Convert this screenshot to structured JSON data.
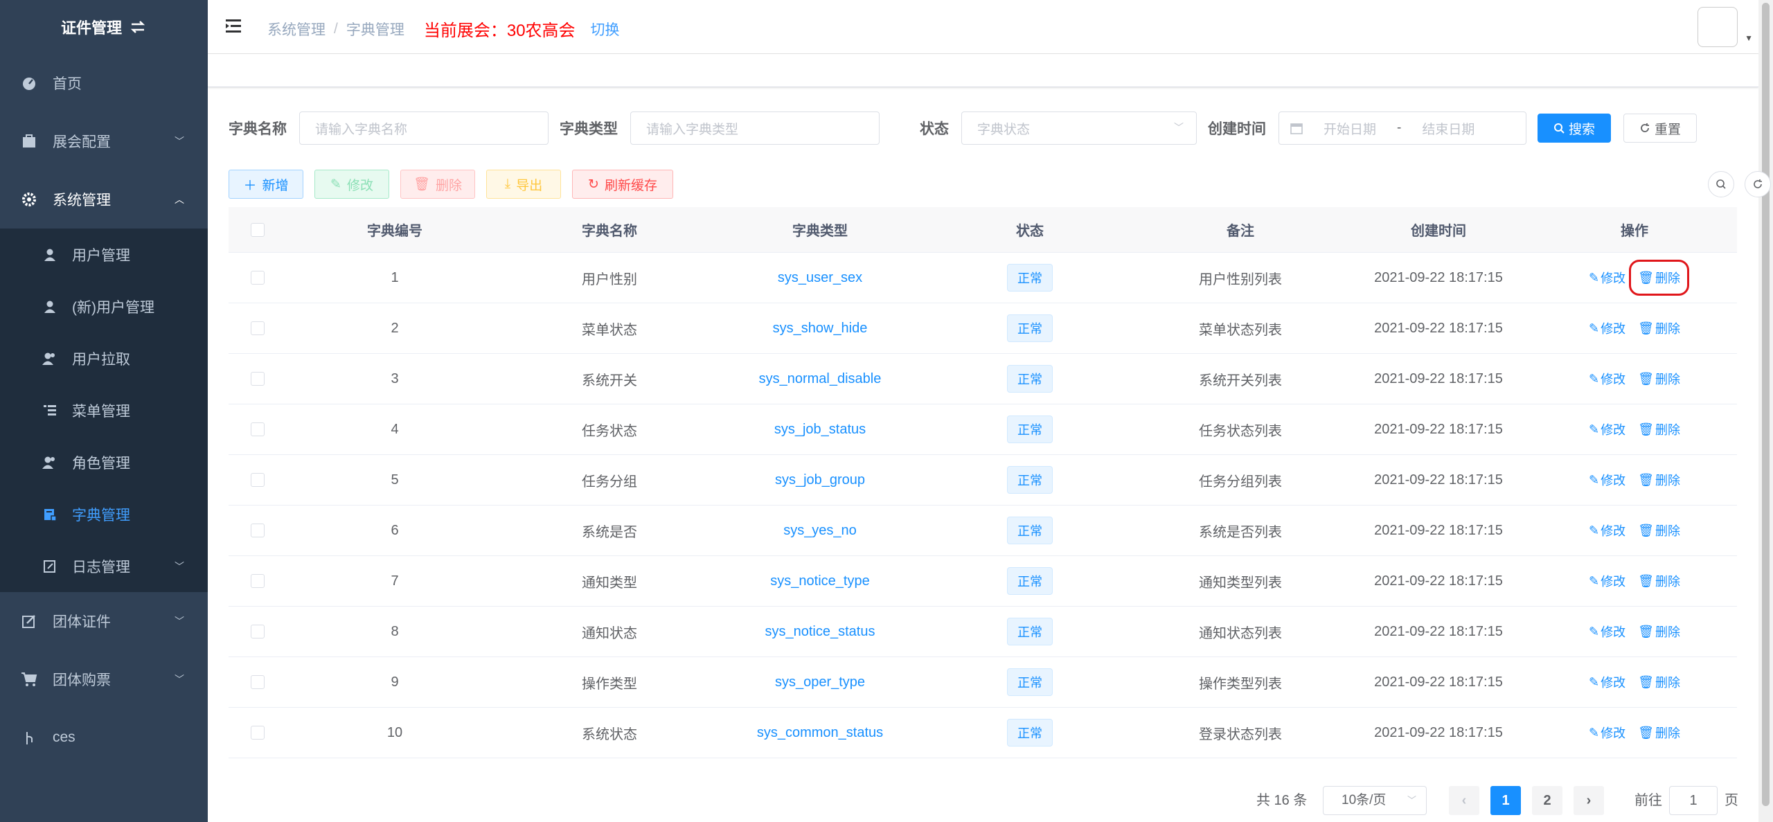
{
  "sidebar": {
    "logo": "证件管理",
    "items": [
      {
        "label": "首页"
      },
      {
        "label": "展会配置"
      },
      {
        "label": "系统管理"
      },
      {
        "label": "团体证件"
      },
      {
        "label": "团体购票"
      },
      {
        "label": "ces"
      }
    ],
    "sub_items": [
      {
        "label": "用户管理"
      },
      {
        "label": "(新)用户管理"
      },
      {
        "label": "用户拉取"
      },
      {
        "label": "菜单管理"
      },
      {
        "label": "角色管理"
      },
      {
        "label": "字典管理"
      },
      {
        "label": "日志管理"
      }
    ]
  },
  "header": {
    "crumb1": "系统管理",
    "sep": "/",
    "crumb2": "字典管理",
    "expo_label": "当前展会：",
    "expo_name": "30农高会",
    "switch": "切换"
  },
  "search": {
    "name_label": "字典名称",
    "name_placeholder": "请输入字典名称",
    "type_label": "字典类型",
    "type_placeholder": "请输入字典类型",
    "status_label": "状态",
    "status_placeholder": "字典状态",
    "time_label": "创建时间",
    "start_placeholder": "开始日期",
    "range_sep": "-",
    "end_placeholder": "结束日期",
    "search_btn": "搜索",
    "reset_btn": "重置"
  },
  "toolbar": {
    "add": "新增",
    "edit": "修改",
    "delete": "删除",
    "export": "导出",
    "refresh": "刷新缓存"
  },
  "table": {
    "headers": [
      "字典编号",
      "字典名称",
      "字典类型",
      "状态",
      "备注",
      "创建时间",
      "操作"
    ],
    "edit_label": "修改",
    "delete_label": "删除",
    "rows": [
      {
        "id": "1",
        "name": "用户性别",
        "type": "sys_user_sex",
        "status": "正常",
        "remark": "用户性别列表",
        "time": "2021-09-22 18:17:15"
      },
      {
        "id": "2",
        "name": "菜单状态",
        "type": "sys_show_hide",
        "status": "正常",
        "remark": "菜单状态列表",
        "time": "2021-09-22 18:17:15"
      },
      {
        "id": "3",
        "name": "系统开关",
        "type": "sys_normal_disable",
        "status": "正常",
        "remark": "系统开关列表",
        "time": "2021-09-22 18:17:15"
      },
      {
        "id": "4",
        "name": "任务状态",
        "type": "sys_job_status",
        "status": "正常",
        "remark": "任务状态列表",
        "time": "2021-09-22 18:17:15"
      },
      {
        "id": "5",
        "name": "任务分组",
        "type": "sys_job_group",
        "status": "正常",
        "remark": "任务分组列表",
        "time": "2021-09-22 18:17:15"
      },
      {
        "id": "6",
        "name": "系统是否",
        "type": "sys_yes_no",
        "status": "正常",
        "remark": "系统是否列表",
        "time": "2021-09-22 18:17:15"
      },
      {
        "id": "7",
        "name": "通知类型",
        "type": "sys_notice_type",
        "status": "正常",
        "remark": "通知类型列表",
        "time": "2021-09-22 18:17:15"
      },
      {
        "id": "8",
        "name": "通知状态",
        "type": "sys_notice_status",
        "status": "正常",
        "remark": "通知状态列表",
        "time": "2021-09-22 18:17:15"
      },
      {
        "id": "9",
        "name": "操作类型",
        "type": "sys_oper_type",
        "status": "正常",
        "remark": "操作类型列表",
        "time": "2021-09-22 18:17:15"
      },
      {
        "id": "10",
        "name": "系统状态",
        "type": "sys_common_status",
        "status": "正常",
        "remark": "登录状态列表",
        "time": "2021-09-22 18:17:15"
      }
    ]
  },
  "pagination": {
    "total": "共 16 条",
    "page_size": "10条/页",
    "page1": "1",
    "page2": "2",
    "goto_label": "前往",
    "goto_value": "1",
    "page_suffix": "页"
  },
  "colors": {
    "sidebar_bg": "#304156",
    "submenu_bg": "#1f2d3d",
    "accent": "#1890ff",
    "highlight_box": "#e0161a"
  },
  "icons": {
    "logo": "switch-arrows-icon",
    "home": "dashboard-icon",
    "expo": "briefcase-icon",
    "system": "gear-icon",
    "user": "user-icon",
    "dict": "dictionary-icon",
    "log": "edit-doc-icon",
    "search": "search-icon",
    "refresh": "refresh-icon",
    "calendar": "calendar-icon"
  }
}
